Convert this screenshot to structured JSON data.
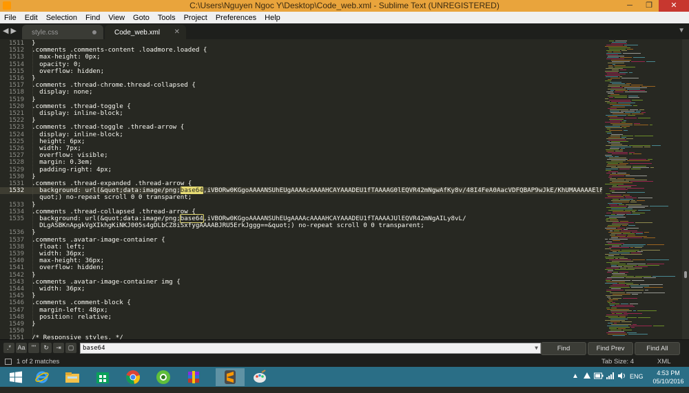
{
  "window": {
    "title": "C:\\Users\\Nguyen Ngoc Y\\Desktop\\Code_web.xml - Sublime Text (UNREGISTERED)",
    "buttons": [
      "─",
      "❐",
      "✕"
    ]
  },
  "menu": [
    "File",
    "Edit",
    "Selection",
    "Find",
    "View",
    "Goto",
    "Tools",
    "Project",
    "Preferences",
    "Help"
  ],
  "tabs": [
    {
      "label": "style.css",
      "active": false
    },
    {
      "label": "Code_web.xml",
      "active": true
    }
  ],
  "editor": {
    "highlighted_line": "1532",
    "lines": [
      {
        "n": "1511",
        "t": "}"
      },
      {
        "n": "1512",
        "t": ".comments .comments-content .loadmore.loaded {"
      },
      {
        "n": "1513",
        "t": "  max-height: 0px;"
      },
      {
        "n": "1514",
        "t": "  opacity: 0;"
      },
      {
        "n": "1515",
        "t": "  overflow: hidden;"
      },
      {
        "n": "1516",
        "t": "}"
      },
      {
        "n": "1517",
        "t": ".comments .thread-chrome.thread-collapsed {"
      },
      {
        "n": "1518",
        "t": "  display: none;"
      },
      {
        "n": "1519",
        "t": "}"
      },
      {
        "n": "1520",
        "t": ".comments .thread-toggle {"
      },
      {
        "n": "1521",
        "t": "  display: inline-block;"
      },
      {
        "n": "1522",
        "t": "}"
      },
      {
        "n": "1523",
        "t": ".comments .thread-toggle .thread-arrow {"
      },
      {
        "n": "1524",
        "t": "  display: inline-block;"
      },
      {
        "n": "1525",
        "t": "  height: 6px;"
      },
      {
        "n": "1526",
        "t": "  width: 7px;"
      },
      {
        "n": "1527",
        "t": "  overflow: visible;"
      },
      {
        "n": "1528",
        "t": "  margin: 0.3em;"
      },
      {
        "n": "1529",
        "t": "  padding-right: 4px;"
      },
      {
        "n": "1530",
        "t": "}"
      },
      {
        "n": "1531",
        "t": ".comments .thread-expanded .thread-arrow {"
      },
      {
        "n": "1532",
        "t": "  background: url(&quot;data:image/png;",
        "m": "base64",
        "mt": "active",
        "r": ",iVBORw0KGgoAAAANSUhEUgAAAAcAAAAHCAYAAADEU1fTAAAAG0lEQVR42mNgwAfKy8v/48I4FeA0AacVDFQBAP9wJkE/KhUMAAAAAElFTkSuQmCC&"
      },
      {
        "n": "",
        "t": "  quot;) no-repeat scroll 0 0 transparent;"
      },
      {
        "n": "1533",
        "t": "}"
      },
      {
        "n": "1534",
        "t": ".comments .thread-collapsed .thread-arrow {"
      },
      {
        "n": "1535",
        "t": "  background: url(&quot;data:image/png;",
        "m": "base64",
        "mt": "outline",
        "r": ",iVBORw0KGgoAAAANSUhEUgAAAAcAAAAHCAYAAADEU1fTAAAAJUlEQVR42mNgAILy8vL/"
      },
      {
        "n": "",
        "t": "  DLgASBKnApgkVgXIkhgKiNKJ005s4gDLbCZ8iSxfygAAAABJRU5ErkJggg==&quot;) no-repeat scroll 0 0 transparent;"
      },
      {
        "n": "1536",
        "t": "}"
      },
      {
        "n": "1537",
        "t": ".comments .avatar-image-container {"
      },
      {
        "n": "1538",
        "t": "  float: left;"
      },
      {
        "n": "1539",
        "t": "  width: 36px;"
      },
      {
        "n": "1540",
        "t": "  max-height: 36px;"
      },
      {
        "n": "1541",
        "t": "  overflow: hidden;"
      },
      {
        "n": "1542",
        "t": "}"
      },
      {
        "n": "1543",
        "t": ".comments .avatar-image-container img {"
      },
      {
        "n": "1544",
        "t": "  width: 36px;"
      },
      {
        "n": "1545",
        "t": "}"
      },
      {
        "n": "1546",
        "t": ".comments .comment-block {"
      },
      {
        "n": "1547",
        "t": "  margin-left: 48px;"
      },
      {
        "n": "1548",
        "t": "  position: relative;"
      },
      {
        "n": "1549",
        "t": "}"
      },
      {
        "n": "1550",
        "t": ""
      },
      {
        "n": "1551",
        "t": "/* Responsive styles. */"
      }
    ]
  },
  "find": {
    "option_buttons": [
      ".*",
      "Aa",
      "\"\"",
      "↻",
      "⇥",
      "▢"
    ],
    "query": "base64",
    "buttons": [
      "Find",
      "Find Prev",
      "Find All"
    ]
  },
  "status": {
    "matches": "1 of 2 matches",
    "tab_size": "Tab Size: 4",
    "syntax": "XML"
  },
  "taskbar": {
    "apps": [
      "windows-start",
      "internet-explorer",
      "file-explorer",
      "store",
      "chrome",
      "coccoc",
      "winrar",
      "sublime-text",
      "paint"
    ],
    "lang": "ENG",
    "time": "4:53 PM",
    "date": "05/10/2016"
  },
  "colors": {
    "accent_titlebar": "#e9a43c",
    "editor_bg": "#272822",
    "match_highlight": "#e6db74",
    "taskbar": "#2a6e86"
  }
}
